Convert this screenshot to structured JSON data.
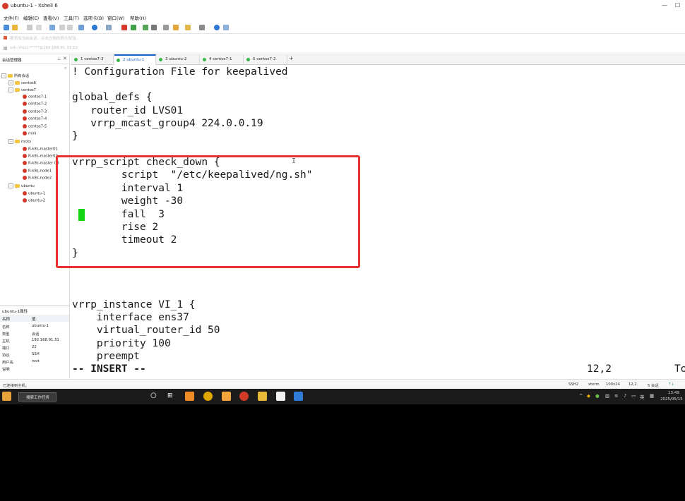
{
  "window": {
    "title": "ubuntu-1 - Xshell 6"
  },
  "menubar": [
    "文件(F)",
    "编辑(E)",
    "查看(V)",
    "工具(T)",
    "选项卡(B)",
    "窗口(W)",
    "帮助(H)"
  ],
  "notice": "要添加当前会话，点击左侧的箭头按钮。",
  "address": "ssh://root:*****@192.168.91.31:22",
  "sidebar": {
    "title": "会话管理器",
    "root": "所有会话",
    "groups": [
      {
        "name": "centos6",
        "items": []
      },
      {
        "name": "centos7",
        "items": [
          "centos7-1",
          "centos7-2",
          "centos7-3",
          "centos7-4",
          "centos7-5",
          "mini"
        ]
      },
      {
        "name": "rocky",
        "items": [
          "R-k8s-master01",
          "R-k8s-master02",
          "R-k8s-master 03",
          "R-k8s-node1",
          "R-k8s-node2"
        ]
      },
      {
        "name": "ubuntu",
        "items": [
          "ubuntu-1",
          "ubuntu-2"
        ]
      }
    ]
  },
  "properties": {
    "title": "ubuntu-1属性",
    "header": {
      "name": "名称",
      "value": "值"
    },
    "rows": [
      {
        "k": "名称",
        "v": "ubuntu-1"
      },
      {
        "k": "类型",
        "v": "会话"
      },
      {
        "k": "主机",
        "v": "192.168.91.31"
      },
      {
        "k": "端口",
        "v": "22"
      },
      {
        "k": "协议",
        "v": "SSH"
      },
      {
        "k": "用户名",
        "v": "root"
      },
      {
        "k": "说明",
        "v": ""
      }
    ]
  },
  "tabs": [
    {
      "label": "1 centos7-3",
      "active": false
    },
    {
      "label": "2 ubuntu-1",
      "active": true
    },
    {
      "label": "3 ubuntu-2",
      "active": false
    },
    {
      "label": "4 centos7-1",
      "active": false
    },
    {
      "label": "5 centos7-2",
      "active": false
    }
  ],
  "terminal": {
    "lines": [
      "! Configuration File for keepalived",
      "",
      "global_defs {",
      "   router_id LVS01",
      "   vrrp_mcast_group4 224.0.0.19",
      "}",
      "",
      "vrrp_script check_down {",
      "        script  \"/etc/keepalived/ng.sh\"",
      "        interval 1",
      "        weight -30",
      "        fall  3",
      "        rise 2",
      "        timeout 2",
      "}",
      "",
      "",
      "vrrp_instance VI_1 {",
      "    interface ens37",
      "    virtual_router_id 50",
      "    priority 100",
      "    preempt"
    ],
    "mode": "-- INSERT --",
    "position": "12,2",
    "scroll": "To"
  },
  "statusbar": {
    "left": "已连接到主机。",
    "proto": "SSH2",
    "term": "xterm",
    "size": "100x24",
    "pos": "12,2",
    "sessions": "5 会话"
  },
  "taskbar": {
    "search": "搜索工作任务",
    "time": "13:49",
    "date": "2025/05/15"
  }
}
